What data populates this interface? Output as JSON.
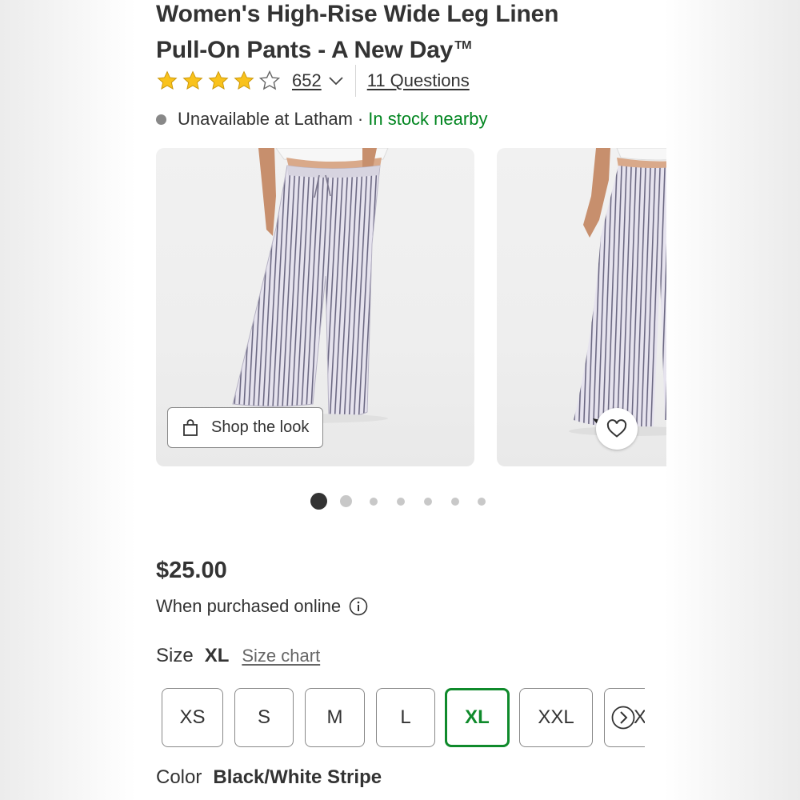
{
  "product": {
    "title_line1": "Women's High-Rise Wide Leg Linen",
    "title_line2": "Pull-On Pants - A New Day",
    "trademark": "TM"
  },
  "rating": {
    "stars": 4,
    "max_stars": 5,
    "review_count": "652",
    "questions_label": "11 Questions"
  },
  "availability": {
    "unavailable_text": "Unavailable at Latham",
    "separator": "·",
    "stock_text": "In stock nearby",
    "stock_color": "#00851f"
  },
  "gallery": {
    "shop_the_look_label": "Shop the look",
    "active_index": 0,
    "dot_count": 7
  },
  "pricing": {
    "price": "$25.00",
    "purchase_note": "When purchased online"
  },
  "size": {
    "label": "Size",
    "selected": "XL",
    "chart_link": "Size chart",
    "options": [
      "XS",
      "S",
      "M",
      "L",
      "XL",
      "XXL"
    ],
    "overflow_partial": "X"
  },
  "color": {
    "label": "Color",
    "selected": "Black/White Stripe"
  },
  "colors": {
    "accent_green": "#0f8a2b",
    "star_gold": "#f9c21b",
    "text": "#333333"
  }
}
